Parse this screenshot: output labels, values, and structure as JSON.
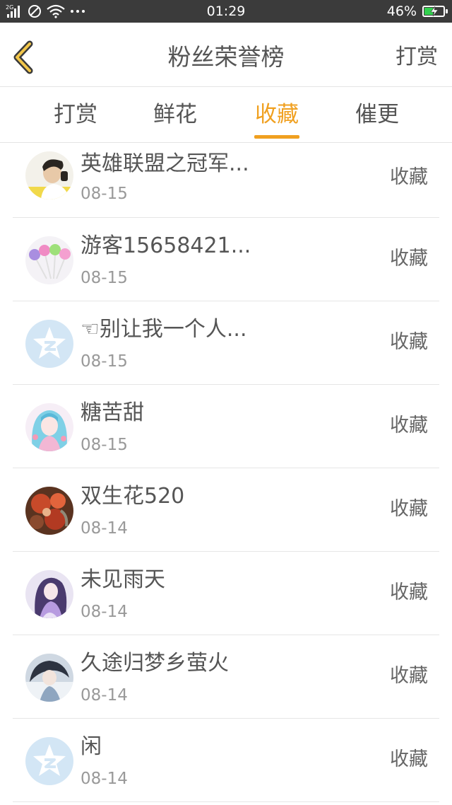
{
  "status_bar": {
    "network": "2G",
    "time": "01:29",
    "battery_percent": "46%",
    "battery_level": 0.46,
    "battery_color": "#33d14f"
  },
  "header": {
    "title": "粉丝荣誉榜",
    "action_label": "打赏"
  },
  "tabs": [
    {
      "label": "打赏",
      "active": false
    },
    {
      "label": "鲜花",
      "active": false
    },
    {
      "label": "收藏",
      "active": true
    },
    {
      "label": "催更",
      "active": false
    }
  ],
  "accent_color": "#f0a020",
  "fans": [
    {
      "name": "英雄联盟之冠军...",
      "date": "08-15",
      "badge": "收藏",
      "avatar": "boy-photo-avatar"
    },
    {
      "name": "游客15658421...",
      "date": "08-15",
      "badge": "收藏",
      "avatar": "lollipop-avatar"
    },
    {
      "name": "☜别让我一个人...",
      "date": "08-15",
      "badge": "收藏",
      "avatar": "default-star-avatar"
    },
    {
      "name": "糖苦甜",
      "date": "08-15",
      "badge": "收藏",
      "avatar": "anime-girl-avatar"
    },
    {
      "name": "双生花520",
      "date": "08-14",
      "badge": "收藏",
      "avatar": "red-flower-avatar"
    },
    {
      "name": "未见雨天",
      "date": "08-14",
      "badge": "收藏",
      "avatar": "anime-violet-avatar"
    },
    {
      "name": "久途归梦乡萤火",
      "date": "08-14",
      "badge": "收藏",
      "avatar": "anime-dark-avatar"
    },
    {
      "name": "闲",
      "date": "08-14",
      "badge": "收藏",
      "avatar": "default-star-avatar"
    }
  ]
}
